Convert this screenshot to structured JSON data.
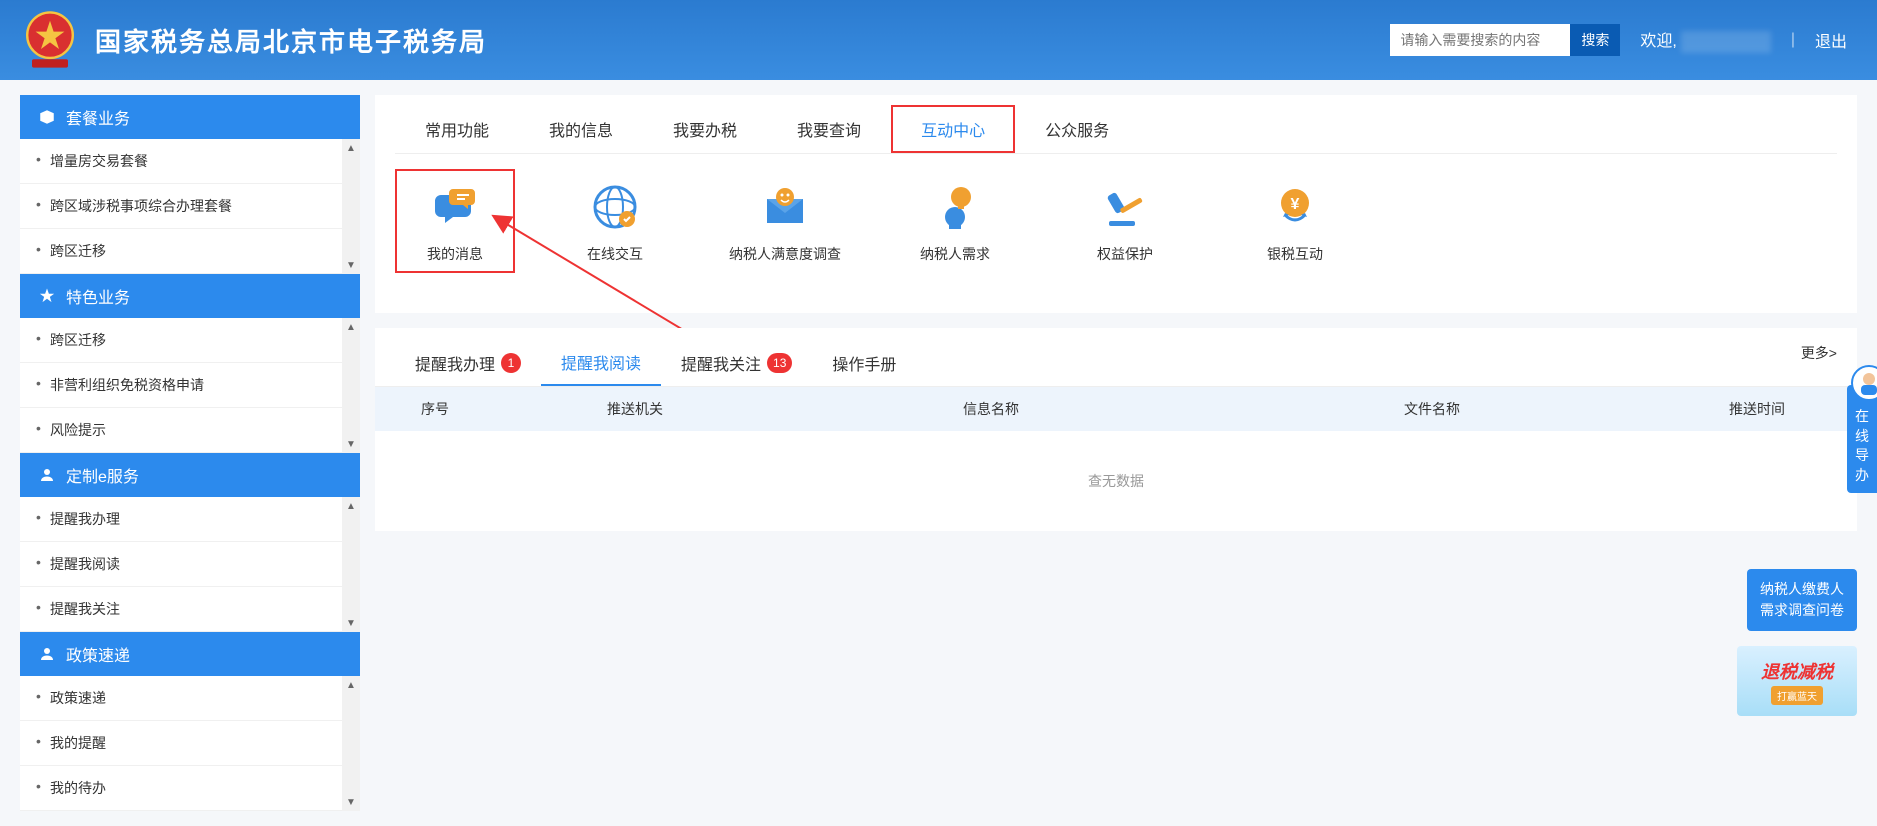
{
  "header": {
    "title": "国家税务总局北京市电子税务局",
    "search_placeholder": "请输入需要搜索的内容",
    "search_btn": "搜索",
    "welcome": "欢迎,",
    "logout": "退出"
  },
  "sidebar": {
    "sections": [
      {
        "title": "套餐业务",
        "items": [
          "增量房交易套餐",
          "跨区域涉税事项综合办理套餐",
          "跨区迁移"
        ]
      },
      {
        "title": "特色业务",
        "items": [
          "跨区迁移",
          "非营利组织免税资格申请",
          "风险提示"
        ]
      },
      {
        "title": "定制e服务",
        "items": [
          "提醒我办理",
          "提醒我阅读",
          "提醒我关注"
        ]
      },
      {
        "title": "政策速递",
        "items": [
          "政策速递",
          "我的提醒",
          "我的待办"
        ]
      }
    ]
  },
  "main_tabs": [
    "常用功能",
    "我的信息",
    "我要办税",
    "我要查询",
    "互动中心",
    "公众服务"
  ],
  "main_tab_active": 4,
  "icons": [
    {
      "label": "我的消息",
      "name": "chat-icon"
    },
    {
      "label": "在线交互",
      "name": "globe-icon"
    },
    {
      "label": "纳税人满意度调查",
      "name": "envelope-icon"
    },
    {
      "label": "纳税人需求",
      "name": "bulb-icon"
    },
    {
      "label": "权益保护",
      "name": "gavel-icon"
    },
    {
      "label": "银税互动",
      "name": "coin-icon"
    }
  ],
  "sub_tabs": [
    {
      "label": "提醒我办理",
      "badge": "1"
    },
    {
      "label": "提醒我阅读",
      "badge": ""
    },
    {
      "label": "提醒我关注",
      "badge": "13"
    },
    {
      "label": "操作手册",
      "badge": ""
    }
  ],
  "sub_tab_active": 1,
  "more_label": "更多>",
  "table": {
    "headers": [
      "序号",
      "推送机关",
      "信息名称",
      "文件名称",
      "推送时间"
    ],
    "no_data": "查无数据"
  },
  "floats": {
    "help": "在线导办",
    "survey": "纳税人缴费人需求调查问卷",
    "banner_t1": "退税减税",
    "banner_t2": "打赢蓝天"
  }
}
